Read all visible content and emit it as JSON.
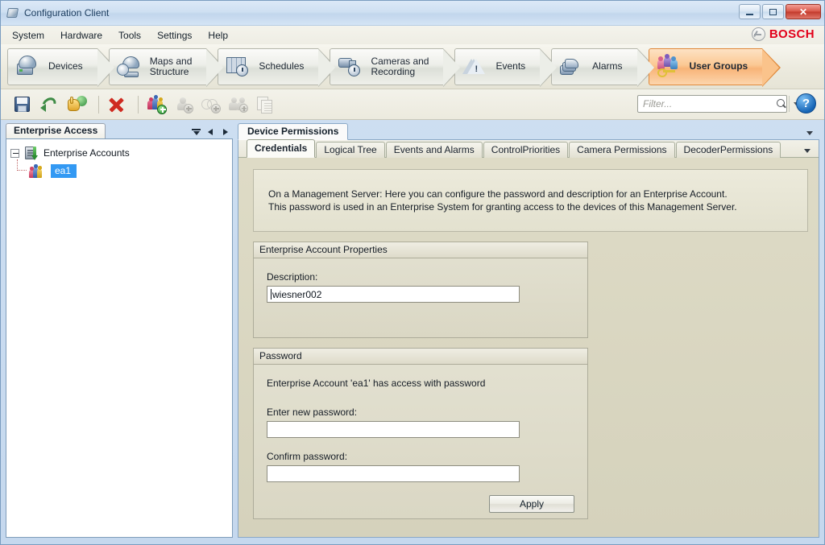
{
  "window": {
    "title": "Configuration Client",
    "icon": "app-icon",
    "minimize": "",
    "maximize": "",
    "close": "✕"
  },
  "menu": {
    "items": [
      "System",
      "Hardware",
      "Tools",
      "Settings",
      "Help"
    ]
  },
  "brand": {
    "name": "BOSCH"
  },
  "ribbon": {
    "tabs": [
      {
        "label": "Devices",
        "icon": "devices-icon",
        "active": false
      },
      {
        "label": "Maps and\nStructure",
        "icon": "maps-structure-icon",
        "active": false
      },
      {
        "label": "Schedules",
        "icon": "schedules-icon",
        "active": false
      },
      {
        "label": "Cameras and\nRecording",
        "icon": "cameras-recording-icon",
        "active": false
      },
      {
        "label": "Events",
        "icon": "events-icon",
        "active": false
      },
      {
        "label": "Alarms",
        "icon": "alarms-icon",
        "active": false
      },
      {
        "label": "User Groups",
        "icon": "user-groups-icon",
        "active": true
      }
    ]
  },
  "toolbar": {
    "buttons": [
      {
        "name": "save-icon",
        "enabled": true
      },
      {
        "name": "undo-icon",
        "enabled": true
      },
      {
        "name": "activate-configuration-icon",
        "enabled": true
      },
      {
        "name": "delete-icon",
        "enabled": true
      },
      {
        "name": "add-user-group-icon",
        "enabled": true
      },
      {
        "name": "add-user-icon",
        "enabled": false
      },
      {
        "name": "add-dual-authorization-group-icon",
        "enabled": false
      },
      {
        "name": "add-enterprise-user-group-icon",
        "enabled": false
      },
      {
        "name": "copy-icon",
        "enabled": false
      }
    ],
    "filter_placeholder": "Filter...",
    "filter_value": "",
    "help_label": "?"
  },
  "sidebar": {
    "tab_label": "Enterprise Access",
    "tree": {
      "root": {
        "label": "Enterprise Accounts",
        "icon": "server-icon",
        "expanded": true
      },
      "children": [
        {
          "label": "ea1",
          "icon": "user-group-people-icon",
          "selected": true
        }
      ]
    }
  },
  "content": {
    "panel_tab": "Device Permissions",
    "subtabs": [
      {
        "label": "Credentials",
        "active": true
      },
      {
        "label": "Logical Tree",
        "active": false
      },
      {
        "label": "Events and Alarms",
        "active": false
      },
      {
        "label": "ControlPriorities",
        "active": false
      },
      {
        "label": "Camera Permissions",
        "active": false
      },
      {
        "label": "DecoderPermissions",
        "active": false
      }
    ],
    "info": {
      "line1": "On a Management Server: Here you can configure the password and description for an Enterprise Account.",
      "line2": "This password is used in an Enterprise System for granting access to the devices of this Management Server."
    },
    "account_properties": {
      "title": "Enterprise Account Properties",
      "description_label": "Description:",
      "description_value": "wiesner002"
    },
    "password": {
      "title": "Password",
      "note": "Enterprise Account 'ea1' has access with password",
      "new_label": "Enter new password:",
      "new_value": "",
      "confirm_label": "Confirm password:",
      "confirm_value": "",
      "apply_label": "Apply"
    }
  },
  "colors": {
    "accent_orange": "#f8b478",
    "brand_red": "#e2001a",
    "selection_blue": "#3399f3",
    "panel_beige": "#d5d2bc"
  }
}
